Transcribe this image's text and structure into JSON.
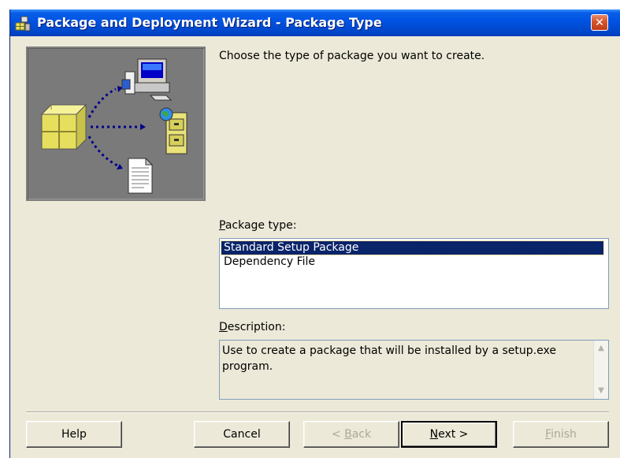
{
  "window": {
    "title": "Package and Deployment Wizard - Package Type",
    "close_glyph": "✕",
    "icon": "package-wizard-icon"
  },
  "banner": {
    "icons": [
      "package-box-icon",
      "computer-icon",
      "file-cabinet-icon",
      "document-icon"
    ]
  },
  "prompt": "Choose the type of package you want to create.",
  "package_type": {
    "label_key": "P",
    "label_rest": "ackage type:",
    "items": [
      "Standard Setup Package",
      "Dependency File"
    ],
    "selected_index": 0
  },
  "description": {
    "label_key": "D",
    "label_rest": "escription:",
    "text": "Use to create a package that will be installed by a setup.exe program."
  },
  "buttons": {
    "help": "Help",
    "cancel": "Cancel",
    "back_prefix": "< ",
    "back_key": "B",
    "back_rest": "ack",
    "next_key": "N",
    "next_rest": "ext >",
    "finish_key": "F",
    "finish_rest": "inish"
  },
  "colors": {
    "titlebar": "#0054e3",
    "selection": "#0a246a",
    "face": "#ece9d8",
    "disabled_text": "#aca899"
  }
}
